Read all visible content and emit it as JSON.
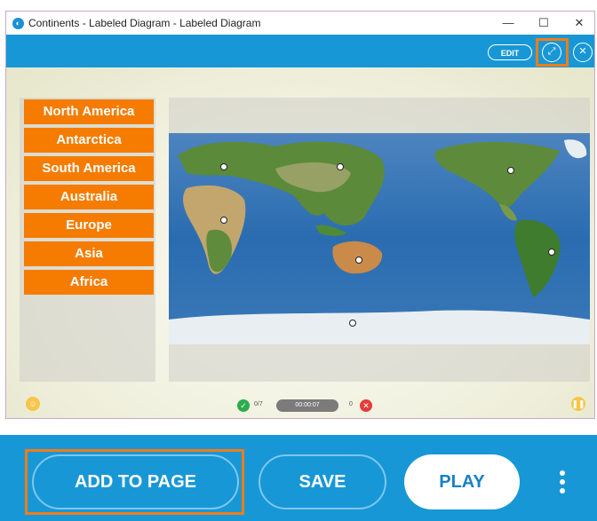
{
  "window": {
    "title": "Continents - Labeled Diagram - Labeled Diagram",
    "app_icon": "app-logo-icon"
  },
  "window_controls": {
    "minimize": "—",
    "maximize": "☐",
    "close": "✕"
  },
  "toolbar": {
    "edit_label": "EDIT",
    "icons": [
      "fullscreen-icon",
      "close-icon"
    ]
  },
  "labels": [
    "North America",
    "Antarctica",
    "South America",
    "Australia",
    "Europe",
    "Asia",
    "Africa"
  ],
  "status": {
    "correct": "0/7",
    "timer": "00:00:07",
    "wrong": "0"
  },
  "bottom": {
    "add_label": "ADD TO PAGE",
    "save_label": "SAVE",
    "play_label": "PLAY"
  },
  "colors": {
    "accent_blue": "#1897d6",
    "label_orange": "#f57c00",
    "highlight": "#f07c18"
  }
}
